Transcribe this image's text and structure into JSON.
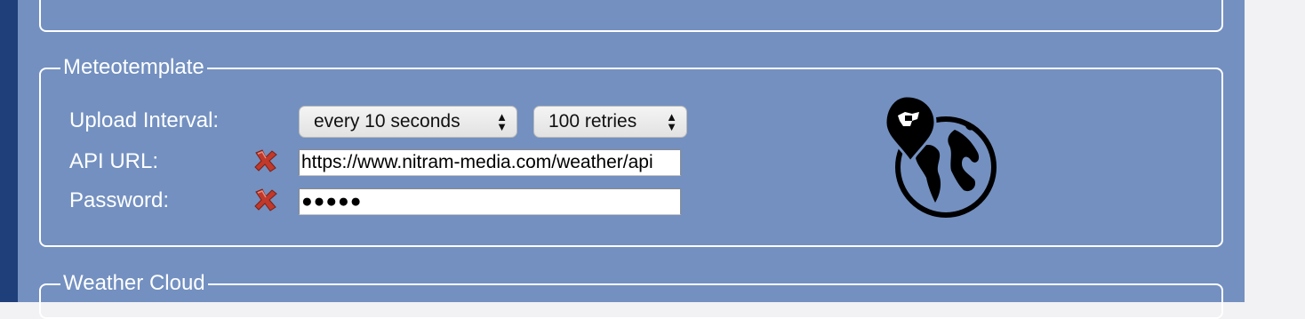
{
  "meteotemplate": {
    "legend": "Meteotemplate",
    "upload_interval_label": "Upload Interval:",
    "interval_select": "every 10 seconds",
    "retries_select": "100 retries",
    "api_url_label": "API URL:",
    "api_url_value": "https://www.nitram-media.com/weather/api",
    "password_label": "Password:",
    "password_value": "●●●●●",
    "error_icon": "red-x-icon",
    "station_icon": "globe-location-pin-icon"
  },
  "weather_cloud": {
    "legend": "Weather Cloud"
  },
  "colors": {
    "panel_bg": "#7390c0",
    "border": "#ffffff",
    "error": "#c0392b"
  }
}
